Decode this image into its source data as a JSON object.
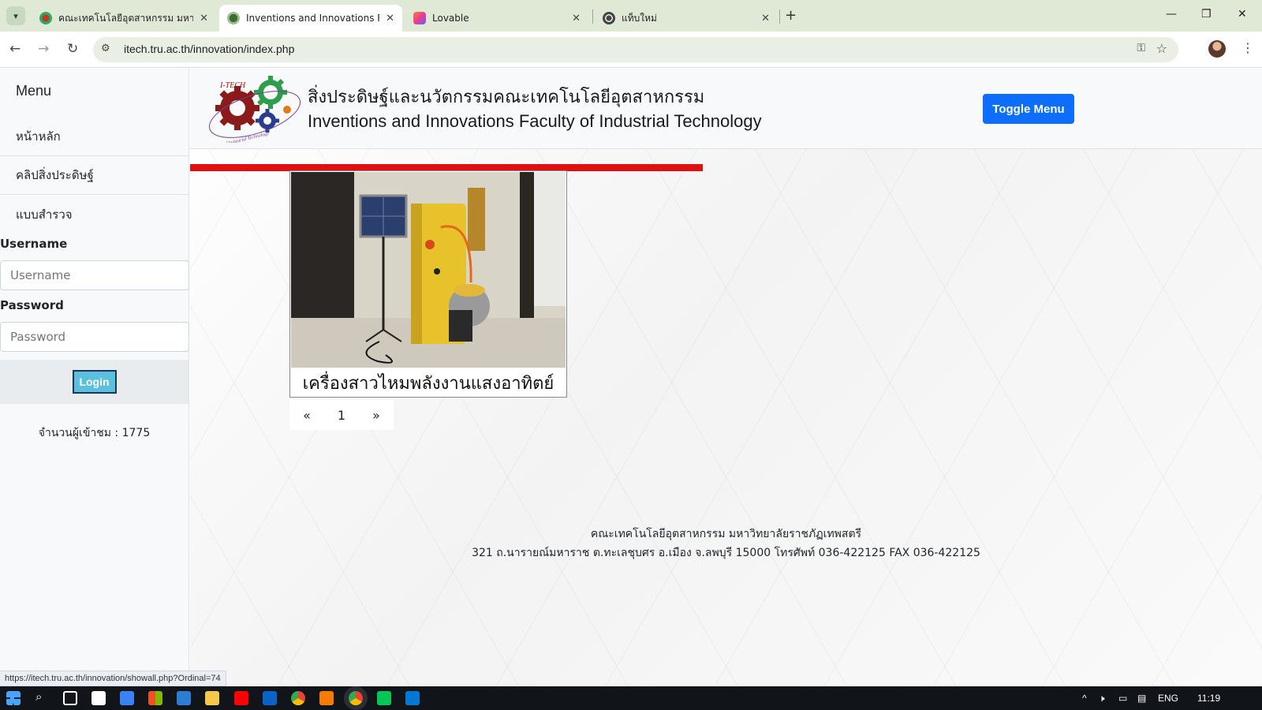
{
  "browser": {
    "tabs": [
      {
        "title": "คณะเทคโนโลยีอุตสาหกรรม มหาวิทยา",
        "active": false
      },
      {
        "title": "Inventions and Innovations Facu",
        "active": true
      },
      {
        "title": "Lovable",
        "active": false
      },
      {
        "title": "แท็บใหม่",
        "active": false
      }
    ],
    "url": "itech.tru.ac.th/innovation/index.php",
    "status_url": "https://itech.tru.ac.th/innovation/showall.php?Ordinal=74"
  },
  "sidebar": {
    "heading": "Menu",
    "items": [
      {
        "label": "หน้าหลัก"
      },
      {
        "label": "คลิปสิ่งประดิษฐ์"
      },
      {
        "label": "แบบสำรวจ"
      }
    ],
    "username_label": "Username",
    "username_placeholder": "Username",
    "password_label": "Password",
    "password_placeholder": "Password",
    "login_label": "Login",
    "visitor_count": "จำนวนผู้เข้าชม : 1775"
  },
  "header": {
    "title_th": "สิ่งประดิษฐ์และนวัตกรรมคณะเทคโนโลยีอุตสาหกรรม",
    "title_en": "Inventions and Innovations Faculty of Industrial Technology",
    "toggle_label": "Toggle Menu",
    "logo_text": "I-TECH",
    "logo_subtext": "Faculty of Industrial Technology"
  },
  "content": {
    "card_title": "เครื่องสาวไหมพลังงานแสงอาทิตย์",
    "pagination": {
      "prev": "«",
      "current": "1",
      "next": "»"
    }
  },
  "footer": {
    "line1": "คณะเทคโนโลยีอุตสาหกรรม มหาวิทยาลัยราชภัฏเทพสตรี",
    "line2": "321 ถ.นารายณ์มหาราช ต.ทะเลชุบศร อ.เมือง จ.ลพบุรี 15000 โทรศัพท์ 036-422125 FAX 036-422125"
  },
  "taskbar": {
    "language": "ENG",
    "time": "11:19"
  },
  "colors": {
    "accent_blue": "#0d6efd",
    "red_bar": "#e01010",
    "login_button": "#5bc0de"
  }
}
